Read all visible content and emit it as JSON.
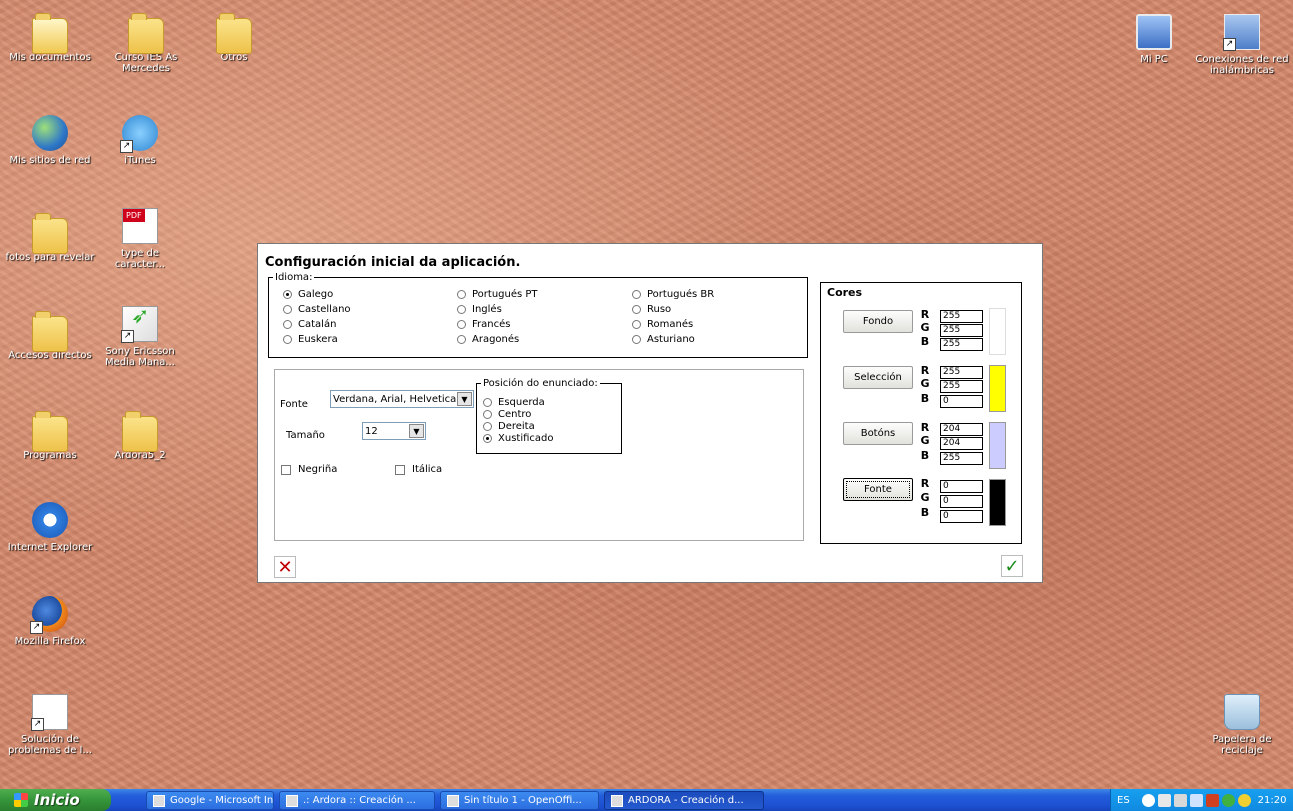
{
  "desktop": {
    "icons_left": [
      {
        "label": "Mis documentos",
        "icon": "my-documents-icon"
      },
      {
        "label": "Curso IES As Mercedes",
        "icon": "folder-icon"
      },
      {
        "label": "Otros",
        "icon": "folder-icon"
      },
      {
        "label": "Mis sitios de red",
        "icon": "network-places-icon"
      },
      {
        "label": "iTunes",
        "icon": "itunes-icon"
      },
      {
        "label": "fotos para revelar",
        "icon": "folder-icon"
      },
      {
        "label": "type de caracter...",
        "icon": "pdf-icon"
      },
      {
        "label": "Accesos directos",
        "icon": "folder-icon"
      },
      {
        "label": "Sony Ericsson Media Mana...",
        "icon": "sony-ericsson-icon"
      },
      {
        "label": "Programas",
        "icon": "folder-icon"
      },
      {
        "label": "Ardora5_2",
        "icon": "folder-icon"
      },
      {
        "label": "Internet Explorer",
        "icon": "internet-explorer-icon"
      },
      {
        "label": "Mozilla Firefox",
        "icon": "firefox-icon"
      },
      {
        "label": "Solución de problemas de I...",
        "icon": "troubleshoot-icon"
      }
    ],
    "icons_right": [
      {
        "label": "Mi PC",
        "icon": "my-computer-icon"
      },
      {
        "label": "Conexiones de red inalámbricas",
        "icon": "wireless-connections-icon"
      },
      {
        "label": "Papelera de reciclaje",
        "icon": "recycle-bin-icon"
      }
    ]
  },
  "dialog": {
    "title": "Configuración inicial da aplicación.",
    "idioma": {
      "legend": "Idioma:",
      "options": [
        "Galego",
        "Castellano",
        "Catalán",
        "Euskera",
        "Portugués PT",
        "Inglés",
        "Francés",
        "Aragonés",
        "Portugués BR",
        "Ruso",
        "Romanés",
        "Asturiano"
      ],
      "selected": "Galego"
    },
    "fonte_label": "Fonte",
    "fonte_value": "Verdana, Arial, Helvetica",
    "tamano_label": "Tamaño",
    "tamano_value": "12",
    "negrina": "Negriña",
    "italica": "Itálica",
    "posicion": {
      "legend": "Posición do enunciado:",
      "options": [
        "Esquerda",
        "Centro",
        "Dereita",
        "Xustificado"
      ],
      "selected": "Xustificado"
    },
    "cores": {
      "title": "Cores",
      "rows": [
        {
          "button": "Fondo",
          "r": "255",
          "g": "255",
          "b": "255",
          "swatch": "#ffffff"
        },
        {
          "button": "Selección",
          "r": "255",
          "g": "255",
          "b": "0",
          "swatch": "#ffff00"
        },
        {
          "button": "Botóns",
          "r": "204",
          "g": "204",
          "b": "255",
          "swatch": "#ccccff"
        },
        {
          "button": "Fonte",
          "r": "0",
          "g": "0",
          "b": "0",
          "swatch": "#000000"
        }
      ],
      "labels": {
        "r": "R",
        "g": "G",
        "b": "B"
      }
    },
    "cancel_glyph": "✕",
    "ok_glyph": "✓"
  },
  "taskbar": {
    "start": "Inicio",
    "tasks": [
      "Google - Microsoft Int...",
      ".: Ardora :: Creación ...",
      "Sin título 1 - OpenOffi...",
      "ARDORA - Creación d..."
    ],
    "language": "ES",
    "clock": "21:20"
  }
}
